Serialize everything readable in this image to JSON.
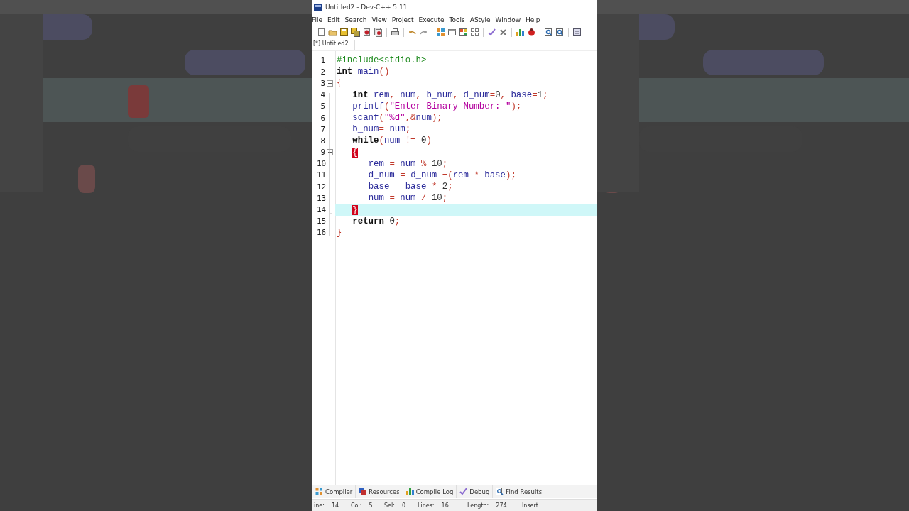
{
  "window": {
    "title": "Untitled2 - Dev-C++ 5.11"
  },
  "menu": [
    "File",
    "Edit",
    "Search",
    "View",
    "Project",
    "Execute",
    "Tools",
    "AStyle",
    "Window",
    "Help"
  ],
  "editor_tabs": [
    {
      "label": "[*] Untitled2",
      "selected": true
    }
  ],
  "code": [
    {
      "number": "1",
      "fold_start": false,
      "current": false,
      "tokens": [
        {
          "kind": "preproc",
          "text": "#include<stdio.h>"
        }
      ]
    },
    {
      "number": "2",
      "fold_start": false,
      "current": false,
      "tokens": [
        {
          "kind": "keyword",
          "text": "int"
        },
        {
          "kind": "ident",
          "text": " main"
        },
        {
          "kind": "punct",
          "text": "()"
        }
      ]
    },
    {
      "number": "3",
      "fold_start": true,
      "current": false,
      "tokens": [
        {
          "kind": "punct",
          "text": "{"
        }
      ]
    },
    {
      "number": "4",
      "fold_start": false,
      "current": false,
      "tokens": [
        {
          "kind": "keyword",
          "text": "   int"
        },
        {
          "kind": "ident",
          "text": " rem"
        },
        {
          "kind": "punct",
          "text": ","
        },
        {
          "kind": "ident",
          "text": " num"
        },
        {
          "kind": "punct",
          "text": ","
        },
        {
          "kind": "ident",
          "text": " b_num"
        },
        {
          "kind": "punct",
          "text": ","
        },
        {
          "kind": "ident",
          "text": " d_num"
        },
        {
          "kind": "punct",
          "text": "="
        },
        {
          "kind": "number",
          "text": "0"
        },
        {
          "kind": "punct",
          "text": ","
        },
        {
          "kind": "ident",
          "text": " base"
        },
        {
          "kind": "punct",
          "text": "="
        },
        {
          "kind": "number",
          "text": "1"
        },
        {
          "kind": "punct",
          "text": ";"
        }
      ]
    },
    {
      "number": "5",
      "fold_start": false,
      "current": false,
      "tokens": [
        {
          "kind": "ident",
          "text": "   printf"
        },
        {
          "kind": "punct",
          "text": "("
        },
        {
          "kind": "string",
          "text": "\"Enter Binary Number: \""
        },
        {
          "kind": "punct",
          "text": ");"
        }
      ]
    },
    {
      "number": "6",
      "fold_start": false,
      "current": false,
      "tokens": [
        {
          "kind": "ident",
          "text": "   scanf"
        },
        {
          "kind": "punct",
          "text": "("
        },
        {
          "kind": "string",
          "text": "\"%d\""
        },
        {
          "kind": "punct",
          "text": ",&"
        },
        {
          "kind": "ident",
          "text": "num"
        },
        {
          "kind": "punct",
          "text": ");"
        }
      ]
    },
    {
      "number": "7",
      "fold_start": false,
      "current": false,
      "tokens": [
        {
          "kind": "ident",
          "text": "   b_num"
        },
        {
          "kind": "punct",
          "text": "="
        },
        {
          "kind": "ident",
          "text": " num"
        },
        {
          "kind": "punct",
          "text": ";"
        }
      ]
    },
    {
      "number": "8",
      "fold_start": false,
      "current": false,
      "tokens": [
        {
          "kind": "keyword",
          "text": "   while"
        },
        {
          "kind": "punct",
          "text": "("
        },
        {
          "kind": "ident",
          "text": "num"
        },
        {
          "kind": "punct",
          "text": " !="
        },
        {
          "kind": "number",
          "text": " 0"
        },
        {
          "kind": "punct",
          "text": ")"
        }
      ]
    },
    {
      "number": "9",
      "fold_start": true,
      "current": false,
      "tokens": [
        {
          "kind": "brace-match",
          "text": "   {"
        }
      ]
    },
    {
      "number": "10",
      "fold_start": false,
      "current": false,
      "tokens": [
        {
          "kind": "ident",
          "text": "      rem"
        },
        {
          "kind": "punct",
          "text": " ="
        },
        {
          "kind": "ident",
          "text": " num"
        },
        {
          "kind": "punct",
          "text": " %"
        },
        {
          "kind": "number",
          "text": " 10"
        },
        {
          "kind": "punct",
          "text": ";"
        }
      ]
    },
    {
      "number": "11",
      "fold_start": false,
      "current": false,
      "tokens": [
        {
          "kind": "ident",
          "text": "      d_num"
        },
        {
          "kind": "punct",
          "text": " ="
        },
        {
          "kind": "ident",
          "text": " d_num"
        },
        {
          "kind": "punct",
          "text": " +("
        },
        {
          "kind": "ident",
          "text": "rem"
        },
        {
          "kind": "punct",
          "text": " *"
        },
        {
          "kind": "ident",
          "text": " base"
        },
        {
          "kind": "punct",
          "text": ");"
        }
      ]
    },
    {
      "number": "12",
      "fold_start": false,
      "current": false,
      "tokens": [
        {
          "kind": "ident",
          "text": "      base"
        },
        {
          "kind": "punct",
          "text": " ="
        },
        {
          "kind": "ident",
          "text": " base"
        },
        {
          "kind": "punct",
          "text": " *"
        },
        {
          "kind": "number",
          "text": " 2"
        },
        {
          "kind": "punct",
          "text": ";"
        }
      ]
    },
    {
      "number": "13",
      "fold_start": false,
      "current": false,
      "tokens": [
        {
          "kind": "ident",
          "text": "      num"
        },
        {
          "kind": "punct",
          "text": " ="
        },
        {
          "kind": "ident",
          "text": " num"
        },
        {
          "kind": "punct",
          "text": " /"
        },
        {
          "kind": "number",
          "text": " 10"
        },
        {
          "kind": "punct",
          "text": ";"
        }
      ]
    },
    {
      "number": "14",
      "fold_start": false,
      "current": true,
      "tokens": [
        {
          "kind": "brace-match",
          "text": "   }"
        }
      ]
    },
    {
      "number": "15",
      "fold_start": false,
      "current": false,
      "tokens": [
        {
          "kind": "keyword",
          "text": "   return"
        },
        {
          "kind": "number",
          "text": " 0"
        },
        {
          "kind": "punct",
          "text": ";"
        }
      ]
    },
    {
      "number": "16",
      "fold_start": false,
      "current": false,
      "tokens": [
        {
          "kind": "punct",
          "text": "}"
        }
      ]
    }
  ],
  "bottom_tabs": [
    "Compiler",
    "Resources",
    "Compile Log",
    "Debug",
    "Find Results"
  ],
  "status_bar": [
    {
      "label": "ine:",
      "value": "14"
    },
    {
      "label": "Col:",
      "value": "5"
    },
    {
      "label": "Sel:",
      "value": "0"
    },
    {
      "label": "Lines:",
      "value": "16"
    },
    {
      "label": "Length:",
      "value": "274"
    },
    {
      "label": "Insert"
    }
  ]
}
